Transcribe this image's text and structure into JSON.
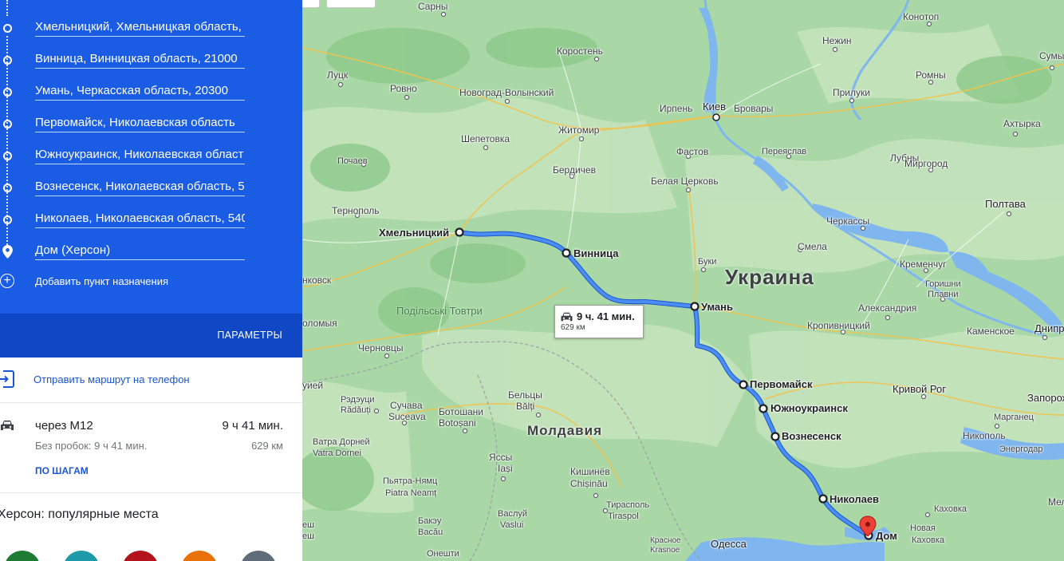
{
  "directions": {
    "stops": [
      {
        "label": "Хмельницкий, Хмельницкая область,"
      },
      {
        "label": "Винница, Винницкая область, 21000"
      },
      {
        "label": "Умань, Черкасская область, 20300"
      },
      {
        "label": "Первомайск, Николаевская область"
      },
      {
        "label": "Южноукраинск, Николаевская област"
      },
      {
        "label": "Вознесенск, Николаевская область, 5"
      },
      {
        "label": "Николаев, Николаевская область, 540"
      },
      {
        "label": "Дом (Херсон)"
      }
    ],
    "add_destination": "Добавить пункт назначения",
    "parameters": "ПАРАМЕТРЫ",
    "send_to_phone": "Отправить маршрут на телефон"
  },
  "route": {
    "via": "через M12",
    "time": "9 ч 41 мин.",
    "traffic": "Без пробок: 9 ч 41 мин.",
    "distance": "629 км",
    "steps_link": "ПО ШАГАМ"
  },
  "popular": {
    "title": "Херсон: популярные места",
    "circle_colors": [
      "#1e7b34",
      "#1e9aa8",
      "#b3141c",
      "#e8710a",
      "#5f6d7a"
    ]
  },
  "map": {
    "callout": {
      "time": "9 ч. 41 мин.",
      "distance": "629 км"
    },
    "countries": {
      "ukraine": "Украина",
      "moldova": "Молдавия"
    },
    "region_label": "Подільські Товтри",
    "route_stops": {
      "khmelnytskyi": "Хмельницкий",
      "vinnytsia": "Винница",
      "uman": "Умань",
      "pervomaisk": "Первомайск",
      "yuzhnoukrainsk": "Южноукраинск",
      "voznesensk": "Вознесенск",
      "mykolaiv": "Николаев",
      "home": "Дом"
    },
    "cities": {
      "sarny": "Сарны",
      "konotop": "Конотоп",
      "korosten": "Коростень",
      "nizhyn": "Нежин",
      "sumy": "Сумы",
      "lutsk": "Луцк",
      "rivne": "Ровно",
      "novohrad": "Новоград-Волынский",
      "romny": "Ромны",
      "irpin": "Ирпень",
      "kyiv": "Киев",
      "brovary": "Бровары",
      "pryluky": "Прилуки",
      "akhtyrka": "Ахтырка",
      "zhytomyr": "Житомир",
      "shepetivka": "Шепетовка",
      "fastiv": "Фастов",
      "pereiaslav": "Переяслав",
      "lubny": "Лубны",
      "pochaiv": "Почаев",
      "berdychiv": "Бердичев",
      "myrhorod": "Миргород",
      "bila_tserkva": "Белая Церковь",
      "ternopil": "Тернополь",
      "poltava": "Полтава",
      "cherkasy": "Черкассы",
      "smila": "Смела",
      "kremenchuk": "Кременчуг",
      "buky": "Буки",
      "horishni_plavni_1": "Горишни",
      "horishni_plavni_2": "Плавни",
      "nkovsk": "нковск",
      "oleksandriia": "Александрия",
      "kolomyia": "оломыя",
      "kropyvnytskyi": "Кропивницкий",
      "kamianske": "Каменское",
      "dnipro": "Днипро",
      "chernivtsi": "Черновцы",
      "kryvyi_rih": "Кривой Рог",
      "zaporizhzhia": "Запорож",
      "hui": "уией",
      "radauti_1": "Рэдэуци",
      "radauti_2": "Rădăuți",
      "balti_1": "Бельцы",
      "balti_2": "Bălți",
      "suceava_1": "Сучава",
      "suceava_2": "Suceava",
      "botosani_1": "Ботошани",
      "botosani_2": "Botoșani",
      "marhanets": "Марганец",
      "nikopol": "Никополь",
      "enerhodar": "Энергодар",
      "vatra_1": "Ватра Дорней",
      "vatra_2": "Vatra Dornei",
      "iasi_1": "Яссы",
      "iasi_2": "Iași",
      "kishinev_1": "Кишинёв",
      "kishinev_2": "Chișinău",
      "mel": "Мел",
      "piatra_1": "Пьятра-Нямц",
      "piatra_2": "Piatra Neamț",
      "tiraspol_1": "Тирасполь",
      "tiraspol_2": "Tiraspol",
      "kakhovka": "Каховка",
      "nova_kakhovka_1": "Новая",
      "nova_kakhovka_2": "Каховка",
      "vaslui_1": "Васлуй",
      "vaslui_2": "Vaslui",
      "bacau_1": "Бакэу",
      "bacau_2": "Bacău",
      "mesh": "еш",
      "esh": "еш",
      "krasnoe_1": "Красное",
      "krasnoe_2": "Krasnoe",
      "onesti": "Онешти",
      "odesa": "Одесса"
    }
  }
}
